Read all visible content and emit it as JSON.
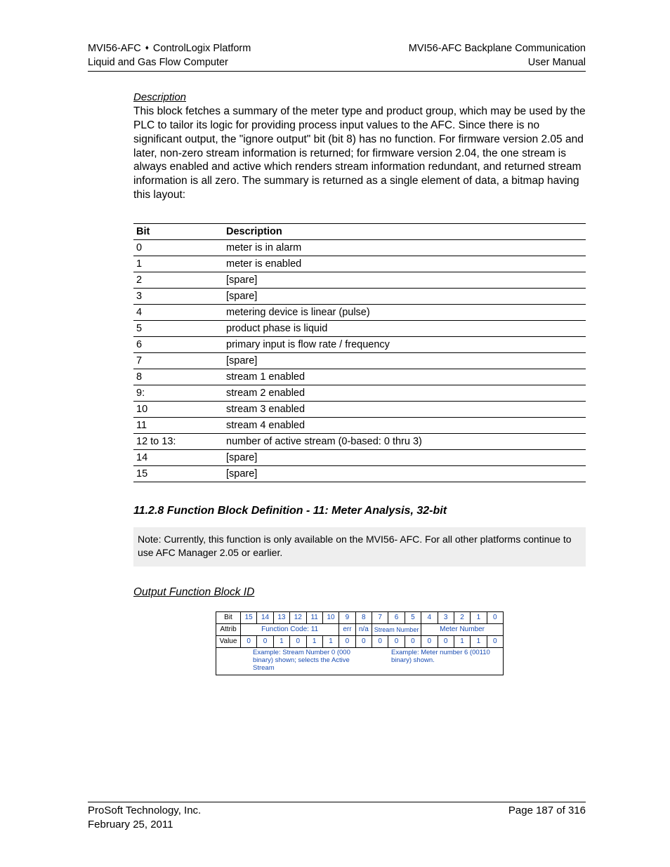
{
  "header": {
    "left_line1_a": "MVI56-AFC",
    "left_line1_b": "ControlLogix Platform",
    "left_line2": "Liquid and Gas Flow Computer",
    "right_line1": "MVI56-AFC Backplane Communication",
    "right_line2": "User Manual"
  },
  "description": {
    "heading": "Description",
    "body": "This block fetches a summary of the meter type and product group, which may be used by the PLC to tailor its logic for providing process input values to the AFC. Since there is no significant output, the \"ignore output\" bit (bit 8) has no function. For firmware version 2.05 and later, non-zero stream information is returned; for firmware version 2.04, the one stream is always enabled and active which renders stream information redundant, and returned stream information is all zero. The summary is returned as a single element of data, a bitmap having this layout:"
  },
  "bit_table": {
    "headers": {
      "bit": "Bit",
      "desc": "Description"
    },
    "rows": [
      {
        "bit": "0",
        "desc": "meter is in alarm"
      },
      {
        "bit": "1",
        "desc": "meter is enabled"
      },
      {
        "bit": "2",
        "desc": "[spare]"
      },
      {
        "bit": "3",
        "desc": "[spare]"
      },
      {
        "bit": "4",
        "desc": "metering device is linear (pulse)"
      },
      {
        "bit": "5",
        "desc": "product phase is liquid"
      },
      {
        "bit": "6",
        "desc": "primary input is flow rate / frequency"
      },
      {
        "bit": "7",
        "desc": "[spare]"
      },
      {
        "bit": "8",
        "desc": "stream 1 enabled"
      },
      {
        "bit": "9:",
        "desc": "stream 2 enabled"
      },
      {
        "bit": "10",
        "desc": "stream 3 enabled"
      },
      {
        "bit": "11",
        "desc": "stream 4 enabled"
      },
      {
        "bit": "12 to 13:",
        "desc": "number of active stream (0-based: 0 thru 3)"
      },
      {
        "bit": "14",
        "desc": "[spare]"
      },
      {
        "bit": "15",
        "desc": "[spare]"
      }
    ]
  },
  "section_heading": "11.2.8 Function Block Definition - 11: Meter Analysis, 32-bit",
  "note": "Note: Currently, this function is only available on the MVI56- AFC. For all other platforms continue to use AFC Manager 2.05 or earlier.",
  "ofb_heading": "Output Function Block ID",
  "diagram": {
    "row_bit_label": "Bit",
    "bits": [
      "15",
      "14",
      "13",
      "12",
      "11",
      "10",
      "9",
      "8",
      "7",
      "6",
      "5",
      "4",
      "3",
      "2",
      "1",
      "0"
    ],
    "row_attrib_label": "Attrib",
    "attrib_fc": "Function Code: 11",
    "attrib_err": "err",
    "attrib_na": "n/a",
    "attrib_sn": "Stream Number",
    "attrib_mn": "Meter Number",
    "row_value_label": "Value",
    "values": [
      "0",
      "0",
      "1",
      "0",
      "1",
      "1",
      "0",
      "0",
      "0",
      "0",
      "0",
      "0",
      "0",
      "1",
      "1",
      "0"
    ],
    "foot_left": "Example: Stream Number 0 (000 binary) shown; selects the Active Stream",
    "foot_right": "Example: Meter number 6 (00110 binary) shown."
  },
  "footer": {
    "company": "ProSoft Technology, Inc.",
    "date": "February 25, 2011",
    "page": "Page 187 of 316"
  }
}
